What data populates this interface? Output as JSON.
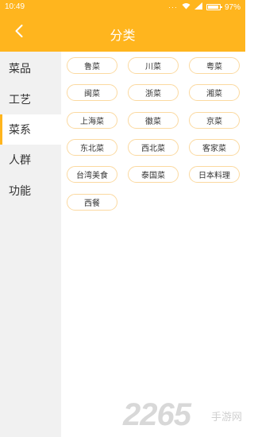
{
  "statusbar": {
    "time": "10:49",
    "battery": "97%",
    "dots": "···"
  },
  "header": {
    "title": "分类",
    "back_icon": "chevron-left-icon"
  },
  "sidebar": {
    "items": [
      {
        "label": "菜品"
      },
      {
        "label": "工艺"
      },
      {
        "label": "菜系",
        "active": true
      },
      {
        "label": "人群"
      },
      {
        "label": "功能"
      }
    ]
  },
  "tags": [
    "鲁菜",
    "川菜",
    "粤菜",
    "闽菜",
    "浙菜",
    "湘菜",
    "上海菜",
    "徽菜",
    "京菜",
    "东北菜",
    "西北菜",
    "客家菜",
    "台湾美食",
    "泰国菜",
    "日本料理",
    "西餐"
  ],
  "watermark": {
    "number": "2265",
    "text": "手游网"
  },
  "colors": {
    "accent": "#FFB51E",
    "tag_border": "#FBD9A0",
    "sidebar_bg": "#F1F1F1"
  }
}
